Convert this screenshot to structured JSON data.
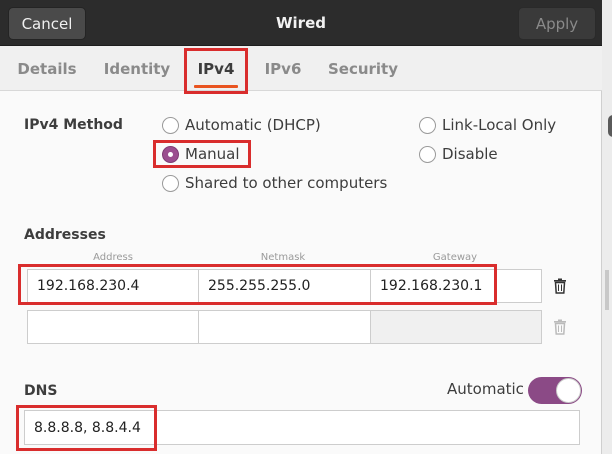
{
  "header": {
    "cancel_label": "Cancel",
    "title": "Wired",
    "apply_label": "Apply"
  },
  "tabs": [
    {
      "label": "Details"
    },
    {
      "label": "Identity"
    },
    {
      "label": "IPv4"
    },
    {
      "label": "IPv6"
    },
    {
      "label": "Security"
    }
  ],
  "active_tab": "IPv4",
  "method": {
    "label": "IPv4 Method",
    "options": [
      {
        "label": "Automatic (DHCP)",
        "checked": false
      },
      {
        "label": "Manual",
        "checked": true
      },
      {
        "label": "Shared to other computers",
        "checked": false
      },
      {
        "label": "Link-Local Only",
        "checked": false
      },
      {
        "label": "Disable",
        "checked": false
      }
    ]
  },
  "addresses": {
    "label": "Addresses",
    "columns": [
      "Address",
      "Netmask",
      "Gateway"
    ],
    "rows": [
      {
        "address": "192.168.230.4",
        "netmask": "255.255.255.0",
        "gateway": "192.168.230.1"
      },
      {
        "address": "",
        "netmask": "",
        "gateway": ""
      }
    ]
  },
  "dns": {
    "label": "DNS",
    "automatic_label": "Automatic",
    "automatic_on": true,
    "value": "8.8.8.8, 8.8.4.4"
  },
  "colors": {
    "accent": "#9b4e8f",
    "highlight": "#d92d2d",
    "tab_underline": "#e95420"
  },
  "icons": {
    "trash": "trash-icon"
  }
}
